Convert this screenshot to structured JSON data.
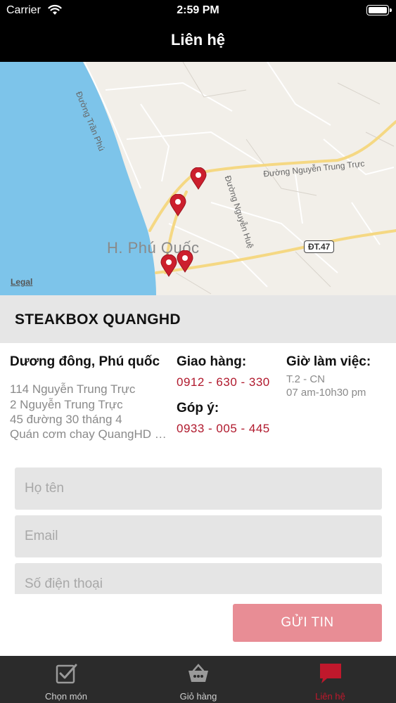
{
  "status_bar": {
    "carrier": "Carrier",
    "time": "2:59 PM"
  },
  "nav": {
    "title": "Liên hệ"
  },
  "map": {
    "city_label": "H. Phú Quốc",
    "roads": {
      "tran_phu": "Đường Trần Phú",
      "nguyen_trung_truc": "Đường Nguyễn Trung Trực",
      "nguyen_hue": "Đường Nguyễn Huệ"
    },
    "route_badge": "ĐT.47",
    "legal": "Legal",
    "water_color": "#7dc4ea",
    "pin_color": "#cc1f2d"
  },
  "store": {
    "name": "STEAKBOX QUANGHD"
  },
  "info": {
    "address_title": "Dương đông, Phú quốc",
    "addresses": [
      "114 Nguyễn Trung Trực",
      "2 Nguyễn Trung Trực",
      "45 đường 30 tháng 4",
      "Quán cơm chay QuangHD phục vụ"
    ],
    "delivery_title": "Giao hàng:",
    "delivery_phone": "0912 - 630 - 330",
    "feedback_title": "Góp ý:",
    "feedback_phone": "0933 - 005 - 445",
    "hours_title": "Giờ làm việc:",
    "hours_days": "T.2 - CN",
    "hours_time": "07 am-10h30 pm"
  },
  "form": {
    "name_placeholder": "Họ tên",
    "email_placeholder": "Email",
    "phone_placeholder": "Số điện thoại",
    "submit_label": "GỬI TIN",
    "submit_color": "#e88d95"
  },
  "tabs": [
    {
      "label": "Chọn món",
      "icon": "checkbox-icon",
      "active": false
    },
    {
      "label": "Giỏ hàng",
      "icon": "basket-icon",
      "active": false
    },
    {
      "label": "Liên hệ",
      "icon": "chat-bubble-icon",
      "active": true
    }
  ],
  "colors": {
    "accent": "#c0182c",
    "bar_background": "#000000",
    "tab_background": "#2b2b2b"
  }
}
